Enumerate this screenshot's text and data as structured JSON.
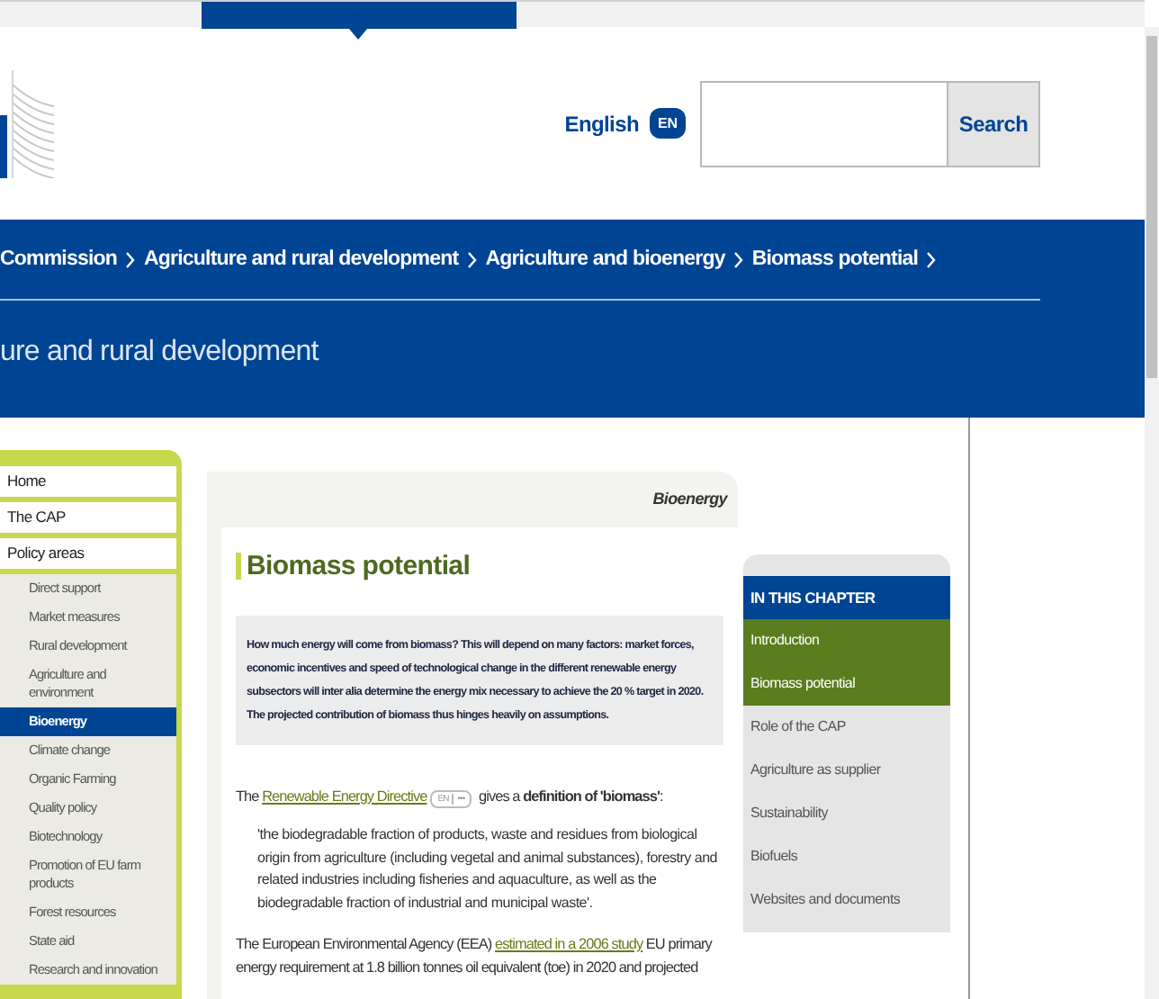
{
  "header": {
    "language": {
      "label": "English",
      "code": "EN"
    },
    "search": {
      "button": "Search"
    }
  },
  "breadcrumb": [
    "Commission",
    "Agriculture and rural development",
    "Agriculture and bioenergy",
    "Biomass potential"
  ],
  "site_title": "ure and rural development",
  "sidebar": {
    "items": [
      {
        "label": "Home",
        "selected": false
      },
      {
        "label": "The CAP",
        "selected": false
      },
      {
        "label": "Policy areas",
        "selected": false,
        "children": [
          {
            "label": "Direct support",
            "selected": false
          },
          {
            "label": "Market measures",
            "selected": false
          },
          {
            "label": "Rural development",
            "selected": false
          },
          {
            "label": "Agriculture and environment",
            "selected": false
          },
          {
            "label": "Bioenergy",
            "selected": true
          },
          {
            "label": "Climate change",
            "selected": false
          },
          {
            "label": "Organic Farming",
            "selected": false
          },
          {
            "label": "Quality policy",
            "selected": false
          },
          {
            "label": "Biotechnology",
            "selected": false
          },
          {
            "label": "Promotion of EU farm products",
            "selected": false
          },
          {
            "label": "Forest resources",
            "selected": false
          },
          {
            "label": "State aid",
            "selected": false
          },
          {
            "label": "Research and innovation",
            "selected": false
          }
        ]
      }
    ]
  },
  "content": {
    "section_label": "Bioenergy",
    "heading": "Biomass potential",
    "intro": "How much energy will come from biomass? This will depend on many factors: market forces, economic incentives and speed of technological change in the different renewable energy subsectors will inter alia determine the energy mix necessary to achieve the 20 % target in 2020. The projected contribution of biomass thus hinges heavily on assumptions.",
    "paragraphs": [
      {
        "kind": "text",
        "before": "The ",
        "link": "Renewable Energy Directive",
        "badge": [
          "EN",
          "•••"
        ],
        "after": " gives a **definition of 'biomass'**:"
      },
      {
        "kind": "quote",
        "text": "'the biodegradable fraction of products, waste and residues from biological origin from agriculture (including vegetal and animal substances), forestry and related industries including fisheries and aquaculture, as well as the biodegradable fraction of industrial and municipal waste'."
      },
      {
        "kind": "text",
        "before": "The European Environmental Agency (EEA) ",
        "link": "estimated in a 2006 study",
        "after": " EU primary energy requirement at 1.8 billion tonnes oil equivalent (toe) in 2020 and projected"
      }
    ]
  },
  "chapter": {
    "title": "IN THIS CHAPTER",
    "items": [
      {
        "label": "Introduction",
        "current": true
      },
      {
        "label": "Biomass potential",
        "current": true
      },
      {
        "label": "Role of the CAP",
        "current": false
      },
      {
        "label": "Agriculture as supplier",
        "current": false
      },
      {
        "label": "Sustainability",
        "current": false
      },
      {
        "label": "Biofuels",
        "current": false
      },
      {
        "label": "Websites and documents",
        "current": false
      }
    ]
  }
}
